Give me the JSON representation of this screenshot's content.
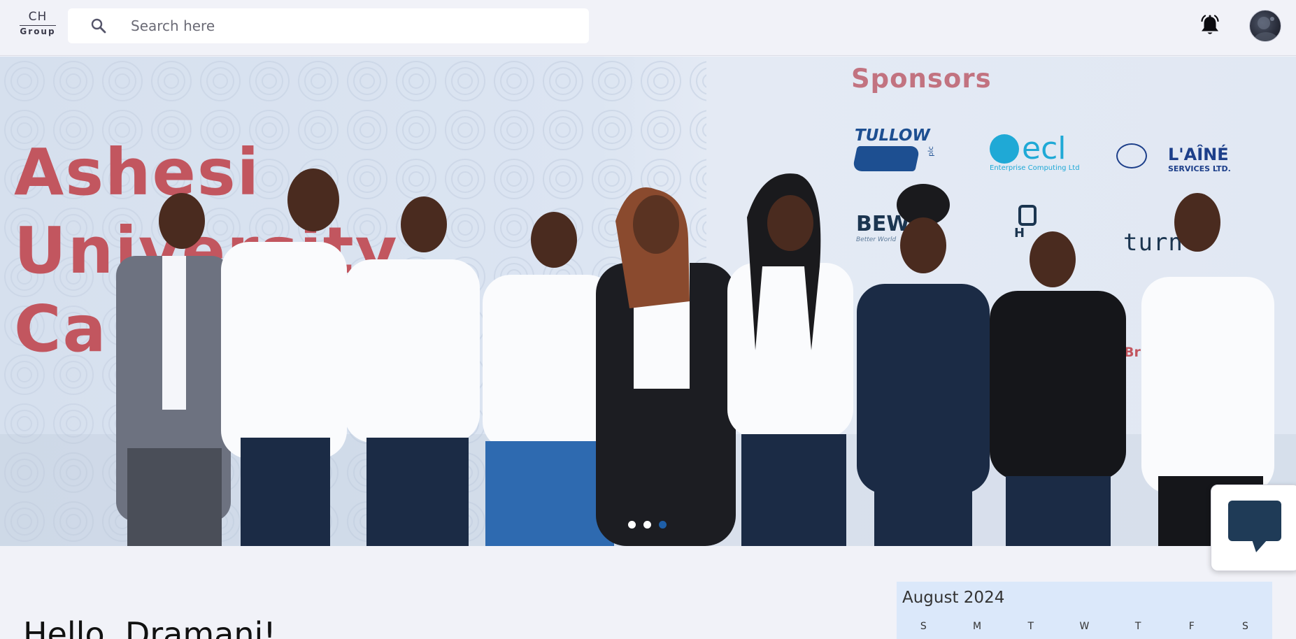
{
  "app": {
    "logo": {
      "top": "CH",
      "bottom": "Group"
    },
    "search": {
      "placeholder": "Search here"
    },
    "icons": {
      "search": "search-icon",
      "notifications": "bell-icon",
      "avatar": "user-avatar",
      "chat": "chat-bubble-icon"
    }
  },
  "hero": {
    "title_lines": [
      "Ashesi",
      "University",
      "Ca"
    ],
    "sponsors_heading": "Sponsors",
    "sponsor_logos": [
      {
        "name": "TULLOW",
        "sub": "plc"
      },
      {
        "name": "ecl",
        "sub": "Enterprise Computing Ltd"
      },
      {
        "name": "L'AÎNÉ",
        "sub": "SERVICES LTD."
      },
      {
        "name": "BEW",
        "sub": "Better World"
      },
      {
        "name": "H",
        "sub": ""
      },
      {
        "name": "turnt",
        "sub": ""
      },
      {
        "name": "Br",
        "sub": ""
      }
    ],
    "carousel": {
      "slides": 3,
      "active_index": 2
    }
  },
  "greeting": "Hello, Dramani!",
  "calendar": {
    "month_label": "August 2024",
    "weekdays": [
      "S",
      "M",
      "T",
      "W",
      "T",
      "F",
      "S"
    ]
  },
  "colors": {
    "accent": "#1e5fa8",
    "hero_title": "#c2565f",
    "sponsors_heading": "#c27380",
    "chat_icon": "#1f3b57",
    "calendar_bg": "#dbe8fa"
  }
}
